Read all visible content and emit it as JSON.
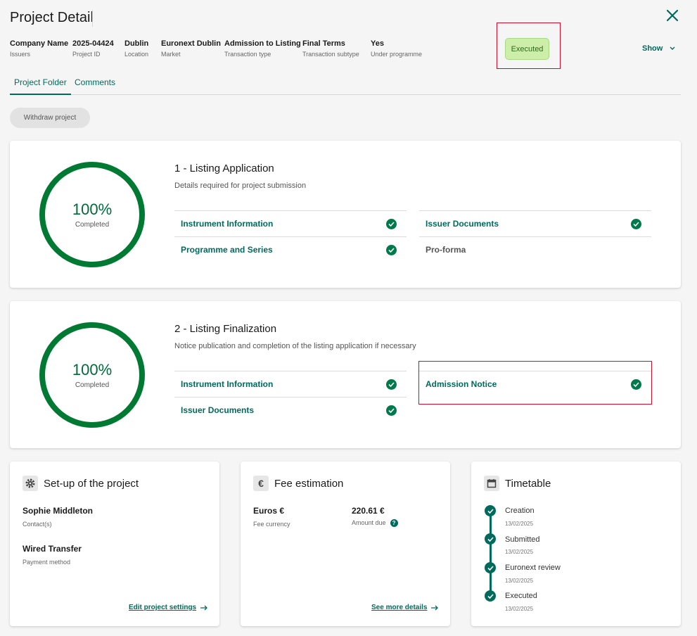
{
  "page": {
    "title": "Project Detail"
  },
  "meta": [
    {
      "value": "Company Name",
      "key": "Issuers"
    },
    {
      "value": "2025-04424",
      "key": "Project ID"
    },
    {
      "value": "Dublin",
      "key": "Location"
    },
    {
      "value": "Euronext Dublin",
      "key": "Market"
    },
    {
      "value": "Admission to Listing",
      "key": "Transaction type"
    },
    {
      "value": "Final Terms",
      "key": "Transaction subtype"
    },
    {
      "value": "Yes",
      "key": "Under programme"
    }
  ],
  "status": {
    "label": "Executed"
  },
  "show_label": "Show",
  "tabs": [
    {
      "label": "Project Folder"
    },
    {
      "label": "Comments"
    }
  ],
  "withdraw_label": "Withdraw project",
  "sections": [
    {
      "title": "1 - Listing Application",
      "description": "Details required for project submission",
      "percent": "100%",
      "completed_label": "Completed",
      "items": [
        {
          "label": "Instrument Information"
        },
        {
          "label": "Issuer Documents"
        },
        {
          "label": "Programme and Series"
        },
        {
          "label": "Pro-forma"
        }
      ]
    },
    {
      "title": "2 - Listing Finalization",
      "description": "Notice publication and completion of the listing application if necessary",
      "percent": "100%",
      "completed_label": "Completed",
      "items": [
        {
          "label": "Instrument Information"
        },
        {
          "label": "Admission Notice"
        },
        {
          "label": "Issuer Documents"
        }
      ]
    }
  ],
  "setup": {
    "title": "Set-up of the project",
    "contact_value": "Sophie Middleton",
    "contact_key": "Contact(s)",
    "payment_value": "Wired Transfer",
    "payment_key": "Payment method",
    "link": "Edit project settings"
  },
  "fees": {
    "title": "Fee estimation",
    "currency_value": "Euros €",
    "currency_key": "Fee currency",
    "amount_value": "220.61 €",
    "amount_key": "Amount due",
    "link": "See more details"
  },
  "timetable": {
    "title": "Timetable",
    "steps": [
      {
        "label": "Creation",
        "date": "13/02/2025"
      },
      {
        "label": "Submitted",
        "date": "13/02/2025"
      },
      {
        "label": "Euronext review",
        "date": "13/02/2025"
      },
      {
        "label": "Executed",
        "date": "13/02/2025"
      }
    ]
  },
  "colors": {
    "accent": "#006a5c",
    "progress": "#007a33",
    "status_bg": "#cdeea8",
    "highlight": "#c8102e"
  }
}
